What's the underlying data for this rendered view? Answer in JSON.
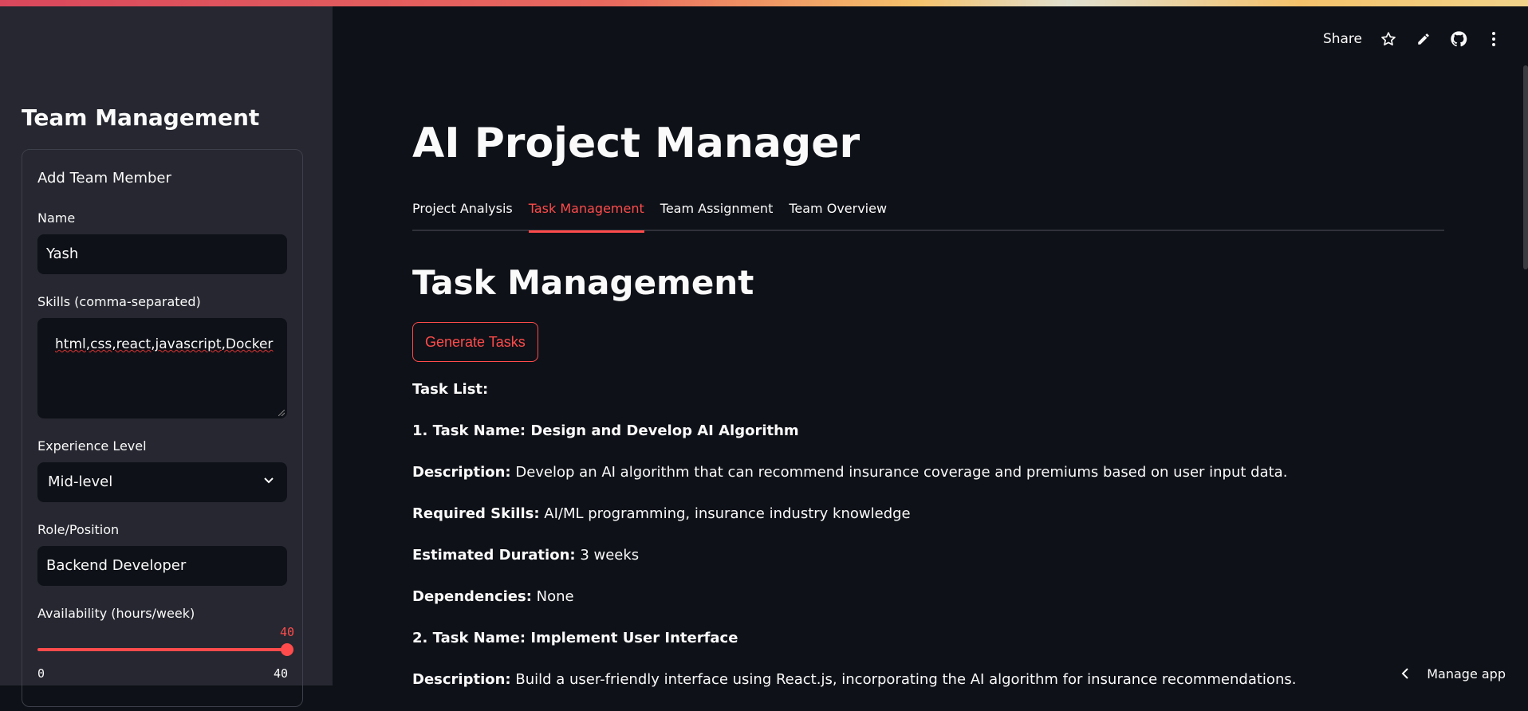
{
  "sidebar": {
    "title": "Team Management",
    "form": {
      "heading": "Add Team Member",
      "name_label": "Name",
      "name_value": "Yash",
      "skills_label": "Skills (comma-separated)",
      "skills_value": "html,css,react,javascript,Docker",
      "experience_label": "Experience Level",
      "experience_value": "Mid-level",
      "role_label": "Role/Position",
      "role_value": "Backend Developer",
      "availability_label": "Availability (hours/week)",
      "availability_value": "40",
      "availability_min": "0",
      "availability_max": "40",
      "availability_fraction": 1.0
    }
  },
  "header": {
    "share_label": "Share",
    "icons": [
      "star-icon",
      "pencil-icon",
      "github-icon",
      "more-vertical-icon"
    ]
  },
  "main": {
    "title": "AI Project Manager",
    "tabs": [
      "Project Analysis",
      "Task Management",
      "Team Assignment",
      "Team Overview"
    ],
    "active_tab": "Task Management",
    "section_title": "Task Management",
    "generate_button": "Generate Tasks",
    "task_list_label": "Task List:",
    "task1": {
      "name": "1. Task Name: Design and Develop AI Algorithm",
      "description_label": "Description:",
      "description": " Develop an AI algorithm that can recommend insurance coverage and premiums based on user input data.",
      "skills_label": "Required Skills:",
      "skills": " AI/ML programming, insurance industry knowledge",
      "duration_label": "Estimated Duration:",
      "duration": " 3 weeks",
      "dependencies_label": "Dependencies:",
      "dependencies": " None"
    },
    "task2": {
      "name": "2. Task Name: Implement User Interface",
      "description_label": "Description:",
      "description": " Build a user-friendly interface using React.js, incorporating the AI algorithm for insurance recommendations."
    }
  },
  "footer": {
    "manage_label": "Manage app"
  },
  "colors": {
    "accent": "#ff4b4b",
    "background": "#0e1117",
    "sidebar": "#262730"
  }
}
